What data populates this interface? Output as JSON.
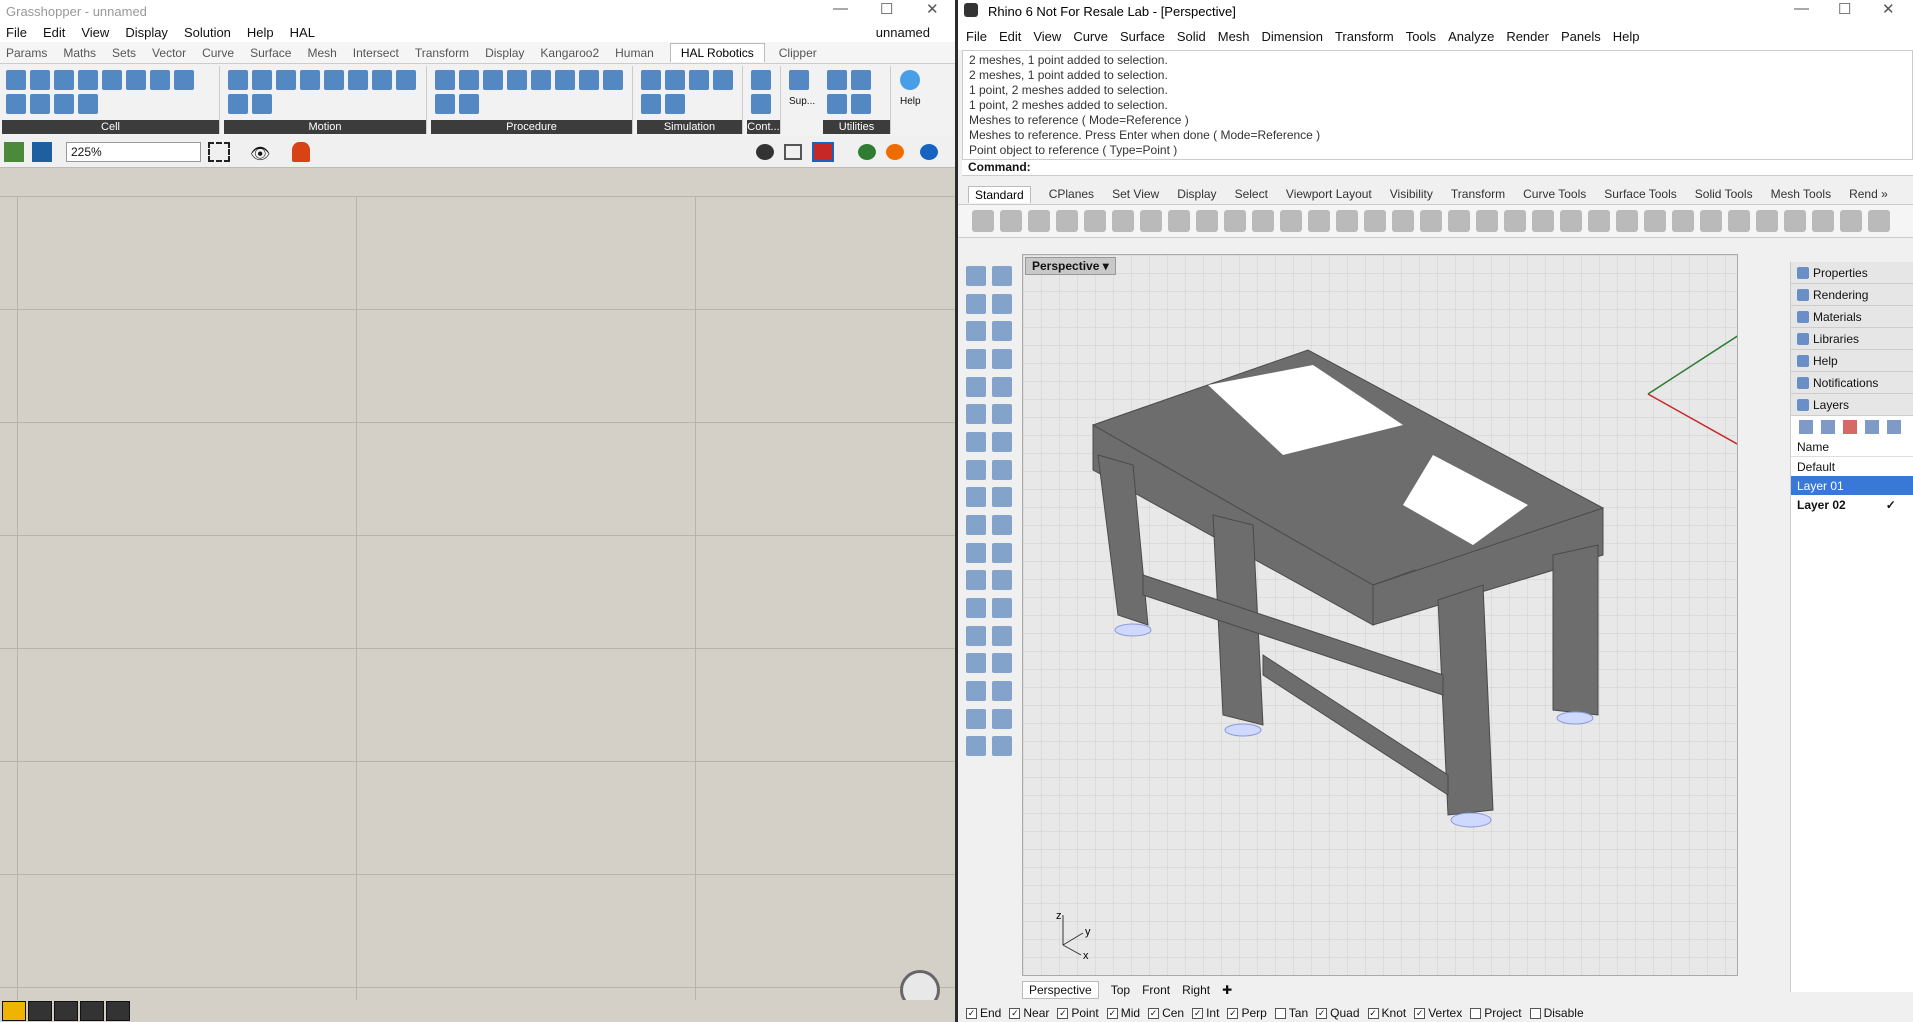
{
  "grasshopper": {
    "title": "Grasshopper - unnamed",
    "doc_name": "unnamed",
    "menu": [
      "File",
      "Edit",
      "View",
      "Display",
      "Solution",
      "Help",
      "HAL"
    ],
    "tabs": [
      "Params",
      "Maths",
      "Sets",
      "Vector",
      "Curve",
      "Surface",
      "Mesh",
      "Intersect",
      "Transform",
      "Display",
      "Kangaroo2",
      "Human",
      "HAL Robotics",
      "Clipper"
    ],
    "active_tab": "HAL Robotics",
    "groups": [
      "Cell",
      "Motion",
      "Procedure",
      "Simulation",
      "Cont...",
      "Utilities"
    ],
    "group_small_labels": [
      "Sup...",
      "Help"
    ],
    "zoom": "225%"
  },
  "rhino": {
    "title": "Rhino 6 Not For Resale Lab - [Perspective]",
    "menu": [
      "File",
      "Edit",
      "View",
      "Curve",
      "Surface",
      "Solid",
      "Mesh",
      "Dimension",
      "Transform",
      "Tools",
      "Analyze",
      "Render",
      "Panels",
      "Help"
    ],
    "command_history": [
      "2 meshes, 1 point added to selection.",
      "2 meshes, 1 point added to selection.",
      "1 point, 2 meshes added to selection.",
      "1 point, 2 meshes added to selection.",
      "Meshes to reference ( Mode=Reference )",
      "Meshes to reference. Press Enter when done ( Mode=Reference )",
      "Point object to reference ( Type=Point )"
    ],
    "command_label": "Command:",
    "toolbar_tabs": [
      "Standard",
      "CPlanes",
      "Set View",
      "Display",
      "Select",
      "Viewport Layout",
      "Visibility",
      "Transform",
      "Curve Tools",
      "Surface Tools",
      "Solid Tools",
      "Mesh Tools",
      "Rend »"
    ],
    "active_toolbar_tab": "Standard",
    "viewport_label": "Perspective",
    "axis_labels": [
      "z",
      "y",
      "x"
    ],
    "viewport_tabs": [
      "Perspective",
      "Top",
      "Front",
      "Right"
    ],
    "panel_tabs": [
      "Properties",
      "Rendering",
      "Materials",
      "Libraries",
      "Help",
      "Notifications",
      "Layers"
    ],
    "layers_header": "Name",
    "layers": [
      {
        "name": "Default",
        "selected": false,
        "current": false
      },
      {
        "name": "Layer 01",
        "selected": true,
        "current": false
      },
      {
        "name": "Layer 02",
        "selected": false,
        "current": true
      }
    ],
    "osnaps": [
      {
        "label": "End",
        "checked": true
      },
      {
        "label": "Near",
        "checked": true
      },
      {
        "label": "Point",
        "checked": true
      },
      {
        "label": "Mid",
        "checked": true
      },
      {
        "label": "Cen",
        "checked": true
      },
      {
        "label": "Int",
        "checked": true
      },
      {
        "label": "Perp",
        "checked": true
      },
      {
        "label": "Tan",
        "checked": false
      },
      {
        "label": "Quad",
        "checked": true
      },
      {
        "label": "Knot",
        "checked": true
      },
      {
        "label": "Vertex",
        "checked": true
      },
      {
        "label": "Project",
        "checked": false
      },
      {
        "label": "Disable",
        "checked": false
      }
    ]
  }
}
